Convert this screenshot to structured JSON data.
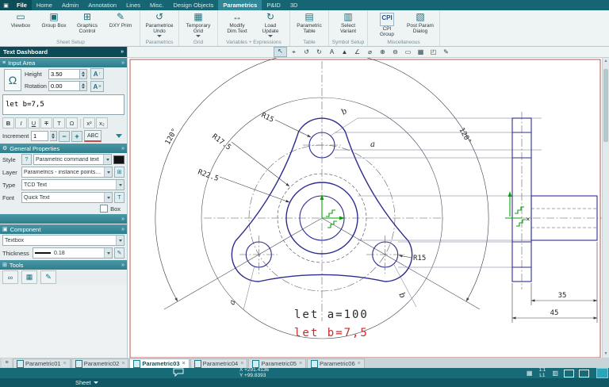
{
  "menubar": {
    "items": [
      "File",
      "Home",
      "Admin",
      "Annotation",
      "Lines",
      "Misc.",
      "Design Objects",
      "Parametrics",
      "P&ID",
      "3D"
    ]
  },
  "ribbon": {
    "groups": [
      {
        "name": "Sheet Setup",
        "buttons": [
          {
            "l1": "Viewbox",
            "l2": "",
            "icon": "▭"
          },
          {
            "l1": "Group Box",
            "l2": "",
            "icon": "▣"
          },
          {
            "l1": "Graphics",
            "l2": "Control",
            "icon": "⊞"
          },
          {
            "l1": "DXY Prim",
            "l2": "",
            "icon": "✎"
          }
        ]
      },
      {
        "name": "Parametrics",
        "buttons": [
          {
            "l1": "Parametrice",
            "l2": "Undo",
            "icon": "↺"
          }
        ]
      },
      {
        "name": "Grid",
        "buttons": [
          {
            "l1": "Temporary",
            "l2": "Grid",
            "icon": "▦"
          }
        ]
      },
      {
        "name": "Variables + Expressions",
        "buttons": [
          {
            "l1": "Modify",
            "l2": "Dim.Text",
            "icon": "↔"
          },
          {
            "l1": "Load",
            "l2": "Update",
            "icon": "↻"
          }
        ]
      },
      {
        "name": "Table",
        "buttons": [
          {
            "l1": "Parametric",
            "l2": "Table",
            "icon": "▤"
          }
        ]
      },
      {
        "name": "Symbol Setup",
        "buttons": [
          {
            "l1": "Select",
            "l2": "Variant",
            "icon": "▥"
          }
        ]
      },
      {
        "name": "Miscellaneous",
        "buttons": [
          {
            "l1": "CPI",
            "l2": "Group",
            "icon": "CPI"
          },
          {
            "l1": "Post Param",
            "l2": "Dialog",
            "icon": "▧"
          }
        ]
      }
    ]
  },
  "panel": {
    "title": "Text Dashboard",
    "sections": {
      "input_area": "Input Area",
      "general": "General Properties",
      "component": "Component",
      "tools": "Tools"
    },
    "omega": "Ω",
    "height_label": "Height",
    "height_value": "3.50",
    "rotation_label": "Rotation",
    "rotation_value": "0.00",
    "a_up": "A",
    "a_up_mark": "↑",
    "a_fit": "A",
    "a_fit_mark": "≡",
    "text_value": "let b=7,5",
    "format": {
      "bold": "B",
      "italic": "I",
      "underline": "U",
      "strike": "T",
      "vertical": "T",
      "omega": "Ω",
      "sup": "x²",
      "sub": "x₂"
    },
    "increment_label": "Increment",
    "increment_value": "1",
    "minus": "−",
    "plus": "+",
    "abc": "ABC",
    "style_label": "Style",
    "style_help": "?",
    "style_value": "Parametric command text",
    "layer_label": "Layer",
    "layer_value": "Parametrics - instance points,table",
    "type_label": "Type",
    "type_value": "TCD Text",
    "font_label": "Font",
    "font_value": "Quick Text",
    "box_label": "Box",
    "component_value": "Textbox",
    "thickness_label": "Thickness",
    "thickness_value": "0.18",
    "tool_icons": {
      "find": "∞",
      "table": "▦",
      "edit": "✎"
    }
  },
  "canvas_toolbar": {
    "icons": [
      {
        "name": "select",
        "glyph": "↖"
      },
      {
        "name": "target",
        "glyph": "⌖"
      },
      {
        "name": "undo",
        "glyph": "↺"
      },
      {
        "name": "redo",
        "glyph": "↻"
      },
      {
        "name": "text",
        "glyph": "A"
      },
      {
        "name": "fill",
        "glyph": "▲"
      },
      {
        "name": "angle",
        "glyph": "∠"
      },
      {
        "name": "diameter",
        "glyph": "⌀"
      },
      {
        "name": "zoom-in",
        "glyph": "⊕"
      },
      {
        "name": "zoom-out",
        "glyph": "⊖"
      },
      {
        "name": "zoom-window",
        "glyph": "▭"
      },
      {
        "name": "grid",
        "glyph": "▦"
      },
      {
        "name": "corner",
        "glyph": "◰"
      },
      {
        "name": "edit",
        "glyph": "✎"
      }
    ]
  },
  "drawing": {
    "labels": {
      "r15_top": "R15",
      "r17_5": "R17.5",
      "r22_5": "R22.5",
      "angle_left": "120°",
      "angle_right": "120°",
      "r15_right": "R15",
      "dim35": "35",
      "dim45": "45",
      "var_b_top": "b",
      "var_a_mid": "a",
      "var_b_bottom": "b",
      "var_a_bottom": "a",
      "x_axis": "×"
    },
    "param_text_black": "let a=100",
    "param_text_red": "let b=7,5"
  },
  "sheet_tabs": {
    "tabs": [
      {
        "label": "Parametric01"
      },
      {
        "label": "Parametric02"
      },
      {
        "label": "Parametric03"
      },
      {
        "label": "Parametric04"
      },
      {
        "label": "Parametric05"
      },
      {
        "label": "Parametric06"
      }
    ]
  },
  "statusbar": {
    "x": "X +291.4136",
    "y": "Y +99.8393",
    "zoom": "1:1",
    "layer": "L1",
    "sheet_label": "Sheet"
  },
  "icons": {
    "close": "×",
    "menu": "≡",
    "pin": "»",
    "app": "▣"
  }
}
